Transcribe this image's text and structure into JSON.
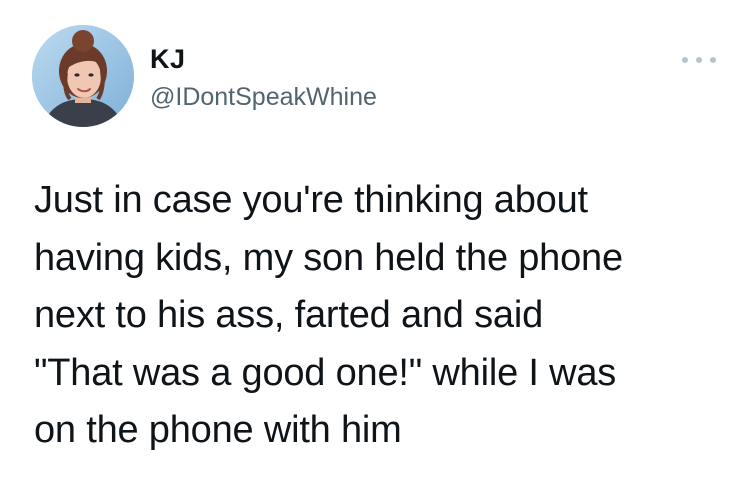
{
  "author": {
    "name": "KJ",
    "handle": "@IDontSpeakWhine",
    "avatar_icon": "profile-photo"
  },
  "more_icon": "more-options-icon",
  "tweet": {
    "text": "Just in case you're thinking about\nhaving kids, my son held the phone\nnext to his ass, farted and said\n\"That was a good one!\" while I was\non the phone with him"
  },
  "colors": {
    "text": "#0f1419",
    "secondary_text": "#536471",
    "more_dots": "#b8c2cb",
    "background": "#ffffff"
  }
}
